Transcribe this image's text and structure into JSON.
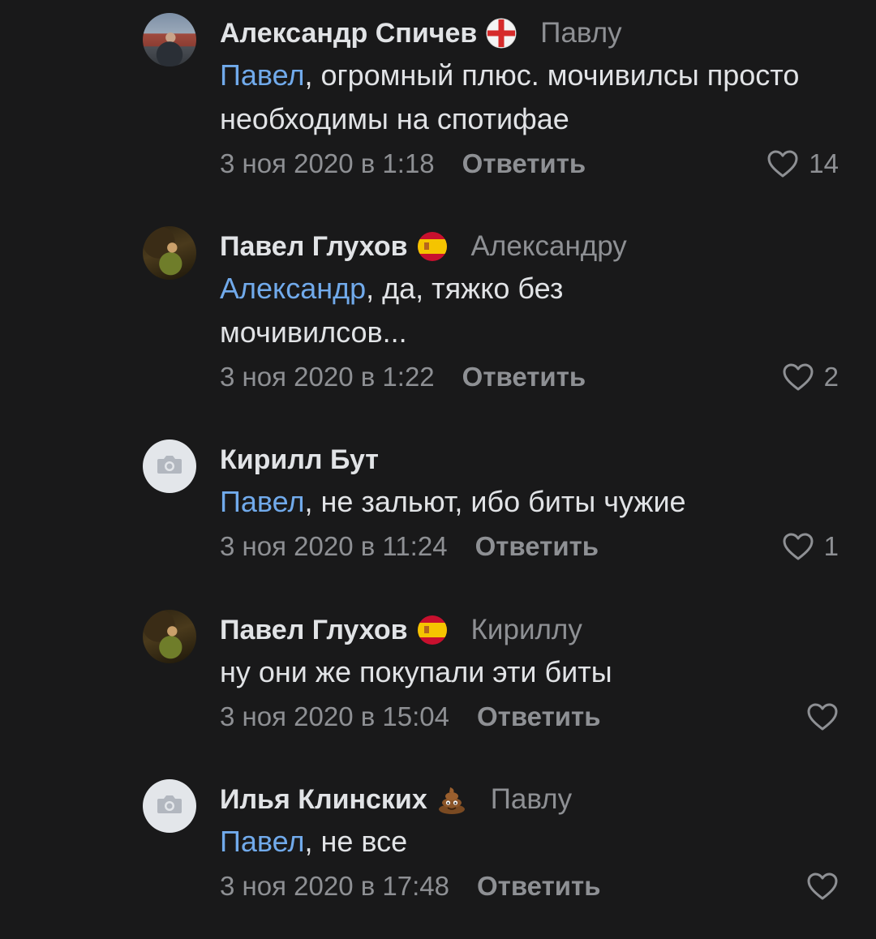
{
  "comments": [
    {
      "author": "Александр Спичев",
      "badge_icon": "red-cross-flag-icon",
      "reply_to": "Павлу",
      "mention": "Павел",
      "text": ", огромный плюс. мочивилсы просто необходимы на спотифае",
      "date": "3 ноя 2020 в 1:18",
      "reply_label": "Ответить",
      "likes": "14"
    },
    {
      "author": "Павел Глухов",
      "badge_icon": "spain-flag-icon",
      "reply_to": "Александру",
      "mention": "Александр",
      "text": ", да, тяжко без мочивилсов...",
      "date": "3 ноя 2020 в 1:22",
      "reply_label": "Ответить",
      "likes": "2"
    },
    {
      "author": "Кирилл Бут",
      "badge_icon": "",
      "reply_to": "",
      "mention": "Павел",
      "text": ", не зальют, ибо биты чужие",
      "date": "3 ноя 2020 в 11:24",
      "reply_label": "Ответить",
      "likes": "1"
    },
    {
      "author": "Павел Глухов",
      "badge_icon": "spain-flag-icon",
      "reply_to": "Кириллу",
      "mention": "",
      "text": "ну они же покупали эти биты",
      "date": "3 ноя 2020 в 15:04",
      "reply_label": "Ответить",
      "likes": ""
    },
    {
      "author": "Илья Клинских",
      "badge_icon": "poop-emoji-icon",
      "reply_to": "Павлу",
      "mention": "Павел",
      "text": ", не все",
      "date": "3 ноя 2020 в 17:48",
      "reply_label": "Ответить",
      "likes": ""
    }
  ],
  "colors": {
    "background": "#19191a",
    "text": "#e1e3e6",
    "secondary": "#8e9094",
    "link": "#71aaeb"
  }
}
